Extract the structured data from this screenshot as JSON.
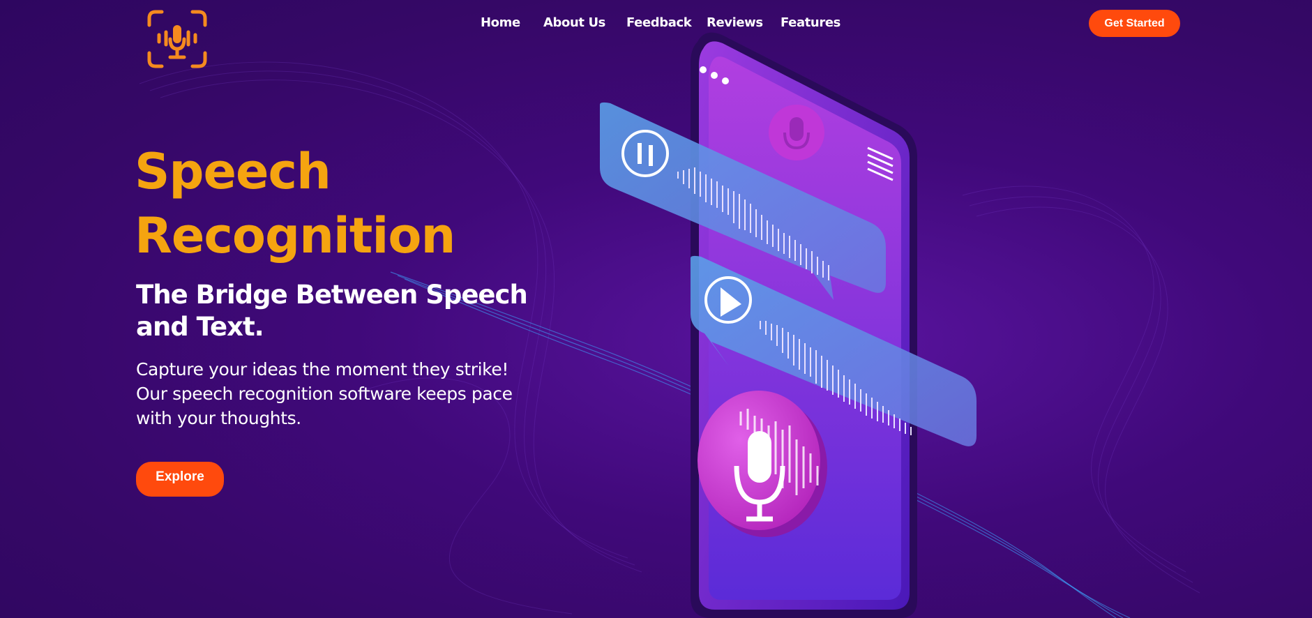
{
  "nav": {
    "items": [
      {
        "label": "Home"
      },
      {
        "label": "About Us"
      },
      {
        "label": "Feedback"
      },
      {
        "label": "Reviews"
      },
      {
        "label": "Features"
      }
    ],
    "cta_label": "Get Started"
  },
  "hero": {
    "title_line1": "Speech",
    "title_line2": "Recognition",
    "subtitle": "The Bridge Between Speech and Text.",
    "description": "Capture your ideas the moment they strike! Our speech recognition software keeps pace with your thoughts.",
    "button_label": "Explore"
  },
  "colors": {
    "background": "#3a0870",
    "accent_orange": "#f5a410",
    "button": "#ff4a0d",
    "logo": "#f58a1f"
  },
  "icons": [
    "microphone-logo-icon",
    "pause-icon",
    "play-icon",
    "menu-icon",
    "microphone-icon",
    "soundwave-icon"
  ]
}
